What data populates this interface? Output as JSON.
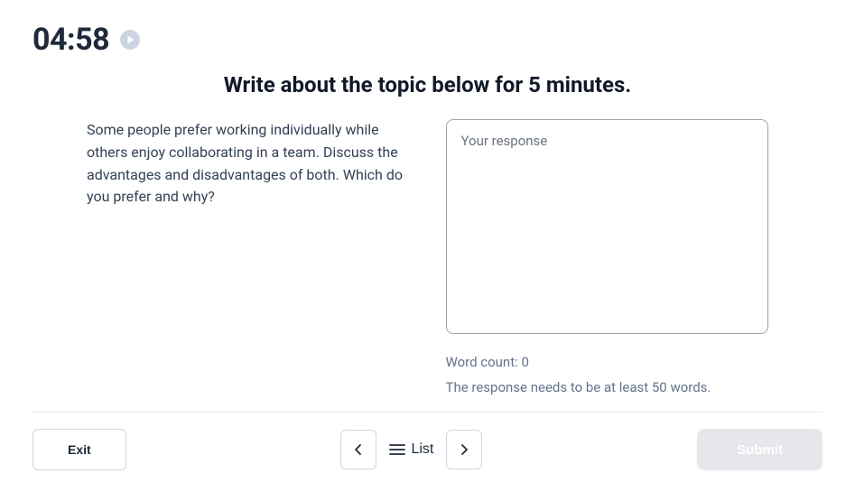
{
  "timer": "04:58",
  "instruction": "Write about the topic below for 5 minutes.",
  "prompt": "Some people prefer working individually while others enjoy collaborating in a team. Discuss the advantages and disadvantages of both. Which do you prefer and why?",
  "response": {
    "placeholder": "Your response",
    "value": ""
  },
  "word_count_label": "Word count: 0",
  "min_words_note": "The response needs to be at least 50 words.",
  "footer": {
    "exit": "Exit",
    "list": "List",
    "submit": "Submit"
  }
}
